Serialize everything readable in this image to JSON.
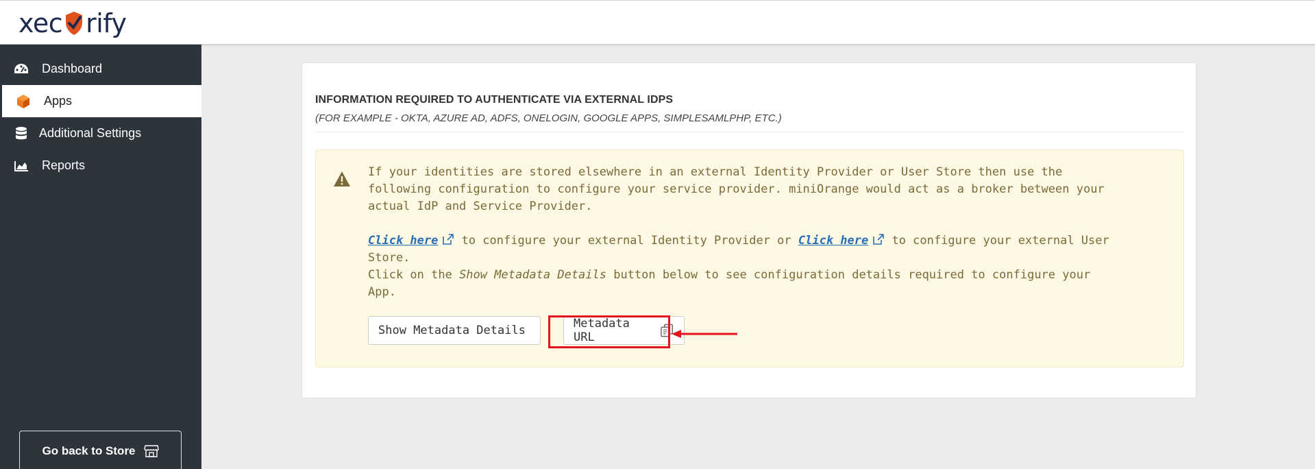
{
  "brand": {
    "logo_left": "xec",
    "logo_right": "rify",
    "accent": "#e0521c",
    "navy": "#1d2a4d"
  },
  "sidebar": {
    "items": [
      {
        "label": "Dashboard",
        "icon": "dashboard-gauge-icon",
        "active": false
      },
      {
        "label": "Apps",
        "icon": "cube-icon",
        "active": true
      },
      {
        "label": "Additional Settings",
        "icon": "database-icon",
        "active": false
      },
      {
        "label": "Reports",
        "icon": "area-chart-icon",
        "active": false
      }
    ],
    "store_button": "Go back to Store",
    "store_icon": "storefront-icon"
  },
  "panel": {
    "heading": "INFORMATION REQUIRED TO AUTHENTICATE VIA EXTERNAL IDPS",
    "subheading": "(FOR EXAMPLE - OKTA, AZURE AD, ADFS, ONELOGIN, GOOGLE APPS, SIMPLESAMLPHP, ETC.)",
    "alert": {
      "icon": "warning-triangle-icon",
      "intro": "If your identities are stored elsewhere in an external Identity Provider or User Store then use the following configuration to configure your service provider. miniOrange would act as a broker between your actual IdP and Service Provider.",
      "link1": "Click here",
      "mid_text": " to configure your external Identity Provider or ",
      "link2": "Click here",
      "end_text": " to configure your external User Store.",
      "line3_pre": "Click on the ",
      "line3_em": "Show Metadata Details",
      "line3_post": " button below to see configuration details required to configure your App."
    },
    "buttons": {
      "show_metadata": "Show Metadata Details",
      "metadata_url": "Metadata URL",
      "copy_icon": "copy-icon"
    }
  },
  "annotation": {
    "highlight_color": "#e3141b"
  }
}
